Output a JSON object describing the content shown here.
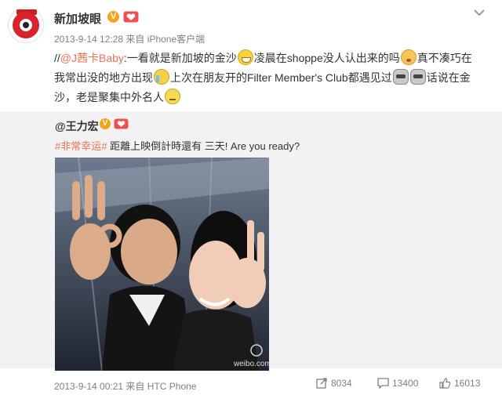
{
  "post": {
    "author": "新加坡眼",
    "verified_badge": "V",
    "timestamp": "2013-9-14 12:28",
    "source_prefix": "来自",
    "source": "iPhone客户端",
    "content": {
      "prefix": "//",
      "mention": "@J茜卡Baby",
      "part1": ":一看就是新加坡的金沙",
      "part2": "凌晨在shoppe没人认出来的吗",
      "part3": "真不凑巧在我常出没的地方出现",
      "part4": "上次在朋友开的Filter Member's Club都遇见过",
      "part5": "话说在金沙，老是聚集中外名人"
    },
    "emoticons": [
      "grin",
      "shy",
      "cry",
      "robot",
      "robot",
      "think"
    ]
  },
  "repost": {
    "author": "@王力宏",
    "verified_badge": "V",
    "topic": "#非常幸运#",
    "text": "距離上映倒計時還有 三天! Are you ready?",
    "image_watermark": "weibo.com"
  },
  "footer": {
    "timestamp": "2013-9-14 00:21",
    "source_prefix": "来自",
    "source": "HTC Phone",
    "repost_count": "8034",
    "comment_count": "13400",
    "like_count": "16013"
  },
  "colors": {
    "link": "#eb7350",
    "meta_text": "#808080",
    "repost_bg": "#f2f2f5",
    "brand_red": "#d8232a",
    "verified": "#f7a21b"
  }
}
